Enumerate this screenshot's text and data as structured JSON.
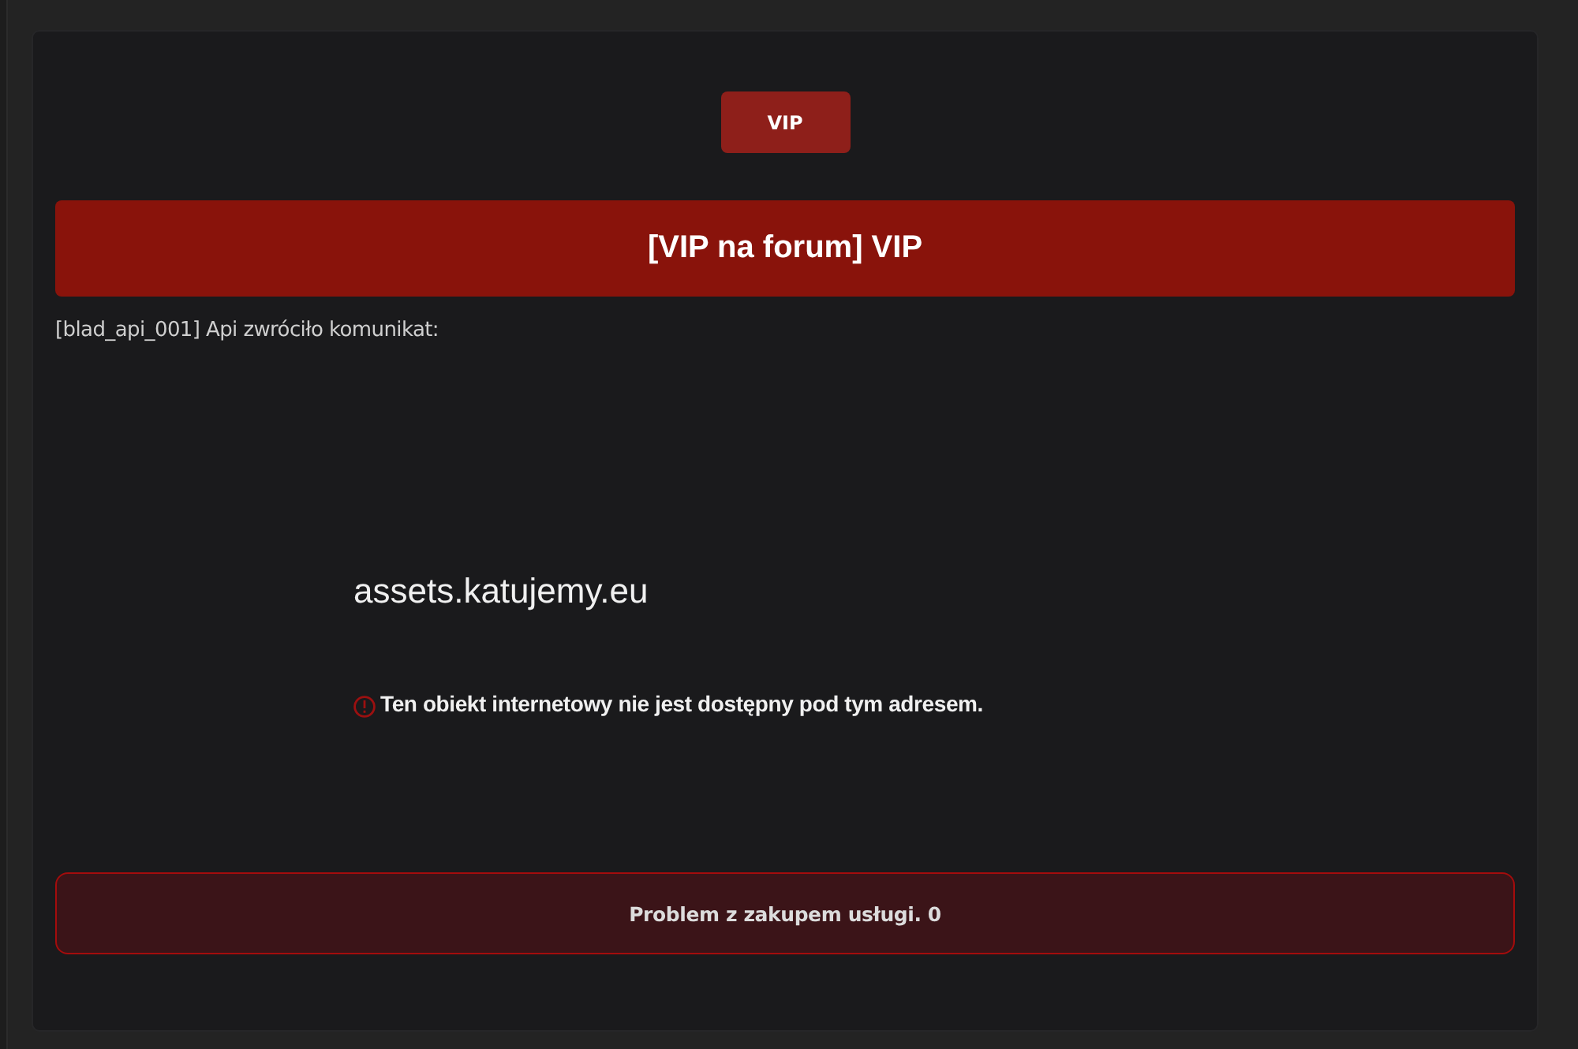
{
  "vip_button": {
    "label": "VIP"
  },
  "title_banner": {
    "title": "[VIP na forum] VIP"
  },
  "error_message": "[blad_api_001] Api zwróciło komunikat:",
  "api_response": {
    "host": "assets.katujemy.eu",
    "warning": "Ten obiekt internetowy nie jest dostępny pod tym adresem."
  },
  "alert": {
    "text": "Problem z zakupem usługi. 0"
  }
}
